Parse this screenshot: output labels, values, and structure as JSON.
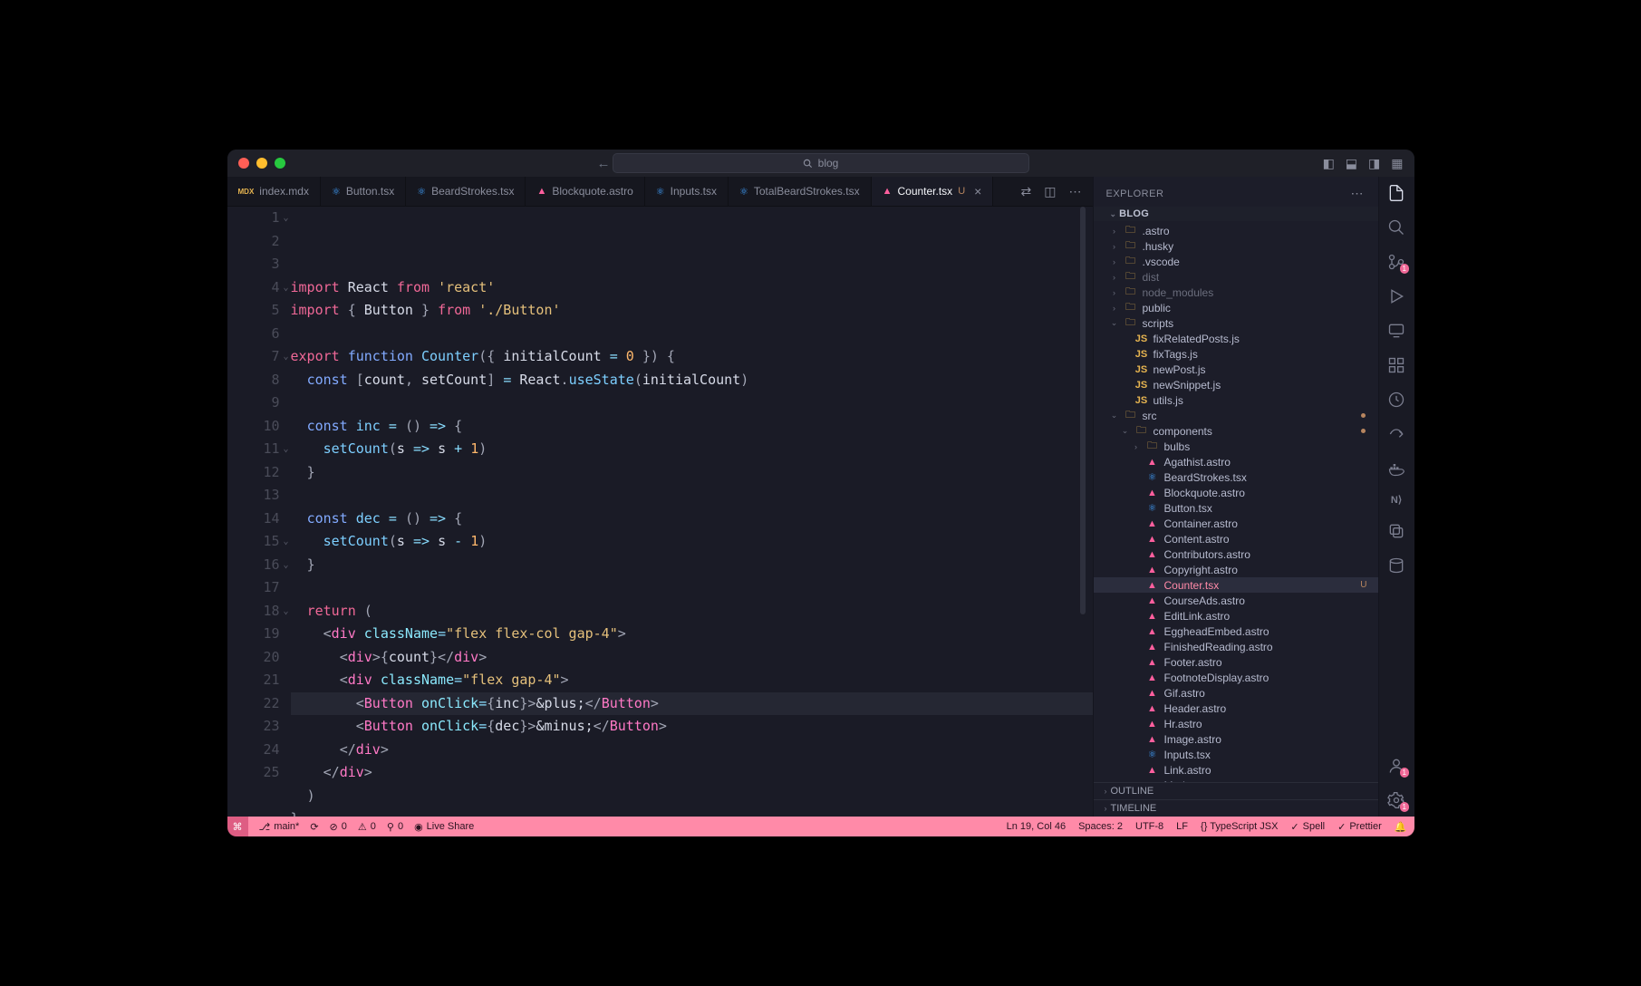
{
  "titlebar": {
    "search_placeholder": "blog"
  },
  "tabs": [
    {
      "icon": "mdx",
      "iconColor": "#e6b450",
      "label": "index.mdx",
      "active": false
    },
    {
      "icon": "react",
      "iconColor": "#40a0ff",
      "label": "Button.tsx",
      "active": false
    },
    {
      "icon": "react",
      "iconColor": "#40a0ff",
      "label": "BeardStrokes.tsx",
      "active": false
    },
    {
      "icon": "astro",
      "iconColor": "#ff5f9e",
      "label": "Blockquote.astro",
      "active": false
    },
    {
      "icon": "react",
      "iconColor": "#40a0ff",
      "label": "Inputs.tsx",
      "active": false
    },
    {
      "icon": "react",
      "iconColor": "#40a0ff",
      "label": "TotalBeardStrokes.tsx",
      "active": false
    },
    {
      "icon": "astro",
      "iconColor": "#ff5f9e",
      "label": "Counter.tsx",
      "suffix": "U",
      "active": true
    }
  ],
  "code": {
    "lines": [
      {
        "n": 1,
        "chev": true,
        "html": "<span class='kw'>import</span> <span class='def'>React</span> <span class='kw'>from</span> <span class='str'>'react'</span>"
      },
      {
        "n": 2,
        "html": "<span class='kw'>import</span> <span class='punc'>{</span> <span class='def'>Button</span> <span class='punc'>}</span> <span class='kw'>from</span> <span class='str'>'./Button'</span>"
      },
      {
        "n": 3,
        "html": ""
      },
      {
        "n": 4,
        "chev": true,
        "html": "<span class='kw'>export</span> <span class='kw2'>function</span> <span class='fn'>Counter</span><span class='punc'>({</span> <span class='def'>initialCount</span> <span class='op'>=</span> <span class='num'>0</span> <span class='punc'>}) {</span>"
      },
      {
        "n": 5,
        "html": "  <span class='kw2'>const</span> <span class='punc'>[</span><span class='def'>count</span><span class='punc'>,</span> <span class='def'>setCount</span><span class='punc'>]</span> <span class='op'>=</span> <span class='def'>React</span><span class='punc'>.</span><span class='fn'>useState</span><span class='punc'>(</span><span class='def'>initialCount</span><span class='punc'>)</span>"
      },
      {
        "n": 6,
        "html": ""
      },
      {
        "n": 7,
        "chev": true,
        "html": "  <span class='kw2'>const</span> <span class='fn'>inc</span> <span class='op'>=</span> <span class='punc'>()</span> <span class='op'>=&gt;</span> <span class='punc'>{</span>"
      },
      {
        "n": 8,
        "html": "    <span class='fn'>setCount</span><span class='punc'>(</span><span class='def'>s</span> <span class='op'>=&gt;</span> <span class='def'>s</span> <span class='op'>+</span> <span class='num'>1</span><span class='punc'>)</span>"
      },
      {
        "n": 9,
        "html": "  <span class='punc'>}</span>"
      },
      {
        "n": 10,
        "html": ""
      },
      {
        "n": 11,
        "chev": true,
        "html": "  <span class='kw2'>const</span> <span class='fn'>dec</span> <span class='op'>=</span> <span class='punc'>()</span> <span class='op'>=&gt;</span> <span class='punc'>{</span>"
      },
      {
        "n": 12,
        "html": "    <span class='fn'>setCount</span><span class='punc'>(</span><span class='def'>s</span> <span class='op'>=&gt;</span> <span class='def'>s</span> <span class='op'>-</span> <span class='num'>1</span><span class='punc'>)</span>"
      },
      {
        "n": 13,
        "html": "  <span class='punc'>}</span>"
      },
      {
        "n": 14,
        "html": ""
      },
      {
        "n": 15,
        "chev": true,
        "html": "  <span class='kw'>return</span> <span class='punc'>(</span>"
      },
      {
        "n": 16,
        "chev": true,
        "html": "    <span class='punc'>&lt;</span><span class='tag'>div</span> <span class='attr'>className</span><span class='op'>=</span><span class='str'>\"flex flex-col gap-4\"</span><span class='punc'>&gt;</span>"
      },
      {
        "n": 17,
        "html": "      <span class='punc'>&lt;</span><span class='tag'>div</span><span class='punc'>&gt;{</span><span class='def'>count</span><span class='punc'>}&lt;/</span><span class='tag'>div</span><span class='punc'>&gt;</span>"
      },
      {
        "n": 18,
        "chev": true,
        "html": "      <span class='punc'>&lt;</span><span class='tag'>div</span> <span class='attr'>className</span><span class='op'>=</span><span class='str'>\"flex gap-4\"</span><span class='punc'>&gt;</span>"
      },
      {
        "n": 19,
        "hl": true,
        "html": "        <span class='punc'>&lt;</span><span class='tag'>Button</span> <span class='attr'>onClick</span><span class='op'>=</span><span class='punc'>{</span><span class='def'>inc</span><span class='punc'>}&gt;</span><span class='def'>&amp;plus;</span><span class='punc'>&lt;/</span><span class='tag'>Button</span><span class='punc'>&gt;</span>"
      },
      {
        "n": 20,
        "html": "        <span class='punc'>&lt;</span><span class='tag'>Button</span> <span class='attr'>onClick</span><span class='op'>=</span><span class='punc'>{</span><span class='def'>dec</span><span class='punc'>}&gt;</span><span class='def'>&amp;minus;</span><span class='punc'>&lt;/</span><span class='tag'>Button</span><span class='punc'>&gt;</span>"
      },
      {
        "n": 21,
        "html": "      <span class='punc'>&lt;/</span><span class='tag'>div</span><span class='punc'>&gt;</span>"
      },
      {
        "n": 22,
        "html": "    <span class='punc'>&lt;/</span><span class='tag'>div</span><span class='punc'>&gt;</span>"
      },
      {
        "n": 23,
        "html": "  <span class='punc'>)</span>"
      },
      {
        "n": 24,
        "html": "<span class='punc'>}</span>"
      },
      {
        "n": 25,
        "html": ""
      }
    ]
  },
  "explorer": {
    "title": "EXPLORER",
    "root": "BLOG",
    "tree": [
      {
        "d": 0,
        "t": "folder",
        "arrow": "›",
        "label": ".astro",
        "dim": false
      },
      {
        "d": 0,
        "t": "folder",
        "arrow": "›",
        "label": ".husky"
      },
      {
        "d": 0,
        "t": "folder",
        "arrow": "›",
        "label": ".vscode"
      },
      {
        "d": 0,
        "t": "folder",
        "arrow": "›",
        "label": "dist",
        "dim": true
      },
      {
        "d": 0,
        "t": "folder",
        "arrow": "›",
        "label": "node_modules",
        "dim": true
      },
      {
        "d": 0,
        "t": "folder",
        "arrow": "›",
        "label": "public"
      },
      {
        "d": 0,
        "t": "folder",
        "arrow": "⌄",
        "label": "scripts"
      },
      {
        "d": 1,
        "t": "js",
        "label": "fixRelatedPosts.js"
      },
      {
        "d": 1,
        "t": "js",
        "label": "fixTags.js"
      },
      {
        "d": 1,
        "t": "js",
        "label": "newPost.js"
      },
      {
        "d": 1,
        "t": "js",
        "label": "newSnippet.js"
      },
      {
        "d": 1,
        "t": "js",
        "label": "utils.js"
      },
      {
        "d": 0,
        "t": "folder",
        "arrow": "⌄",
        "label": "src",
        "dot": true
      },
      {
        "d": 1,
        "t": "folder",
        "arrow": "⌄",
        "label": "components",
        "dot": true
      },
      {
        "d": 2,
        "t": "folder",
        "arrow": "›",
        "label": "bulbs"
      },
      {
        "d": 2,
        "t": "astro",
        "label": "Agathist.astro"
      },
      {
        "d": 2,
        "t": "tsx",
        "label": "BeardStrokes.tsx"
      },
      {
        "d": 2,
        "t": "astro",
        "label": "Blockquote.astro"
      },
      {
        "d": 2,
        "t": "tsx",
        "label": "Button.tsx"
      },
      {
        "d": 2,
        "t": "astro",
        "label": "Container.astro"
      },
      {
        "d": 2,
        "t": "astro",
        "label": "Content.astro"
      },
      {
        "d": 2,
        "t": "astro",
        "label": "Contributors.astro"
      },
      {
        "d": 2,
        "t": "astro",
        "label": "Copyright.astro"
      },
      {
        "d": 2,
        "t": "astro",
        "label": "Counter.tsx",
        "sel": true,
        "badge": "U"
      },
      {
        "d": 2,
        "t": "astro",
        "label": "CourseAds.astro"
      },
      {
        "d": 2,
        "t": "astro",
        "label": "EditLink.astro"
      },
      {
        "d": 2,
        "t": "astro",
        "label": "EggheadEmbed.astro"
      },
      {
        "d": 2,
        "t": "astro",
        "label": "FinishedReading.astro"
      },
      {
        "d": 2,
        "t": "astro",
        "label": "Footer.astro"
      },
      {
        "d": 2,
        "t": "astro",
        "label": "FootnoteDisplay.astro"
      },
      {
        "d": 2,
        "t": "astro",
        "label": "Gif.astro"
      },
      {
        "d": 2,
        "t": "astro",
        "label": "Header.astro"
      },
      {
        "d": 2,
        "t": "astro",
        "label": "Hr.astro"
      },
      {
        "d": 2,
        "t": "astro",
        "label": "Image.astro"
      },
      {
        "d": 2,
        "t": "tsx",
        "label": "Inputs.tsx"
      },
      {
        "d": 2,
        "t": "astro",
        "label": "Link.astro"
      },
      {
        "d": 2,
        "t": "astro",
        "label": "Marker.astro"
      }
    ],
    "panels": [
      "OUTLINE",
      "TIMELINE"
    ]
  },
  "status": {
    "left": [
      {
        "icon": "⎇",
        "label": "main*"
      },
      {
        "icon": "⟳",
        "label": ""
      },
      {
        "icon": "⊘",
        "label": "0"
      },
      {
        "icon": "⚠",
        "label": "0"
      },
      {
        "icon": "⚲",
        "label": "0"
      },
      {
        "icon": "◉",
        "label": "Live Share"
      }
    ],
    "right": [
      {
        "label": "Ln 19, Col 46"
      },
      {
        "label": "Spaces: 2"
      },
      {
        "label": "UTF-8"
      },
      {
        "label": "LF"
      },
      {
        "label": "{} TypeScript JSX"
      },
      {
        "icon": "✓",
        "label": "Spell"
      },
      {
        "icon": "✓",
        "label": "Prettier"
      },
      {
        "icon": "🔔",
        "label": ""
      }
    ]
  }
}
